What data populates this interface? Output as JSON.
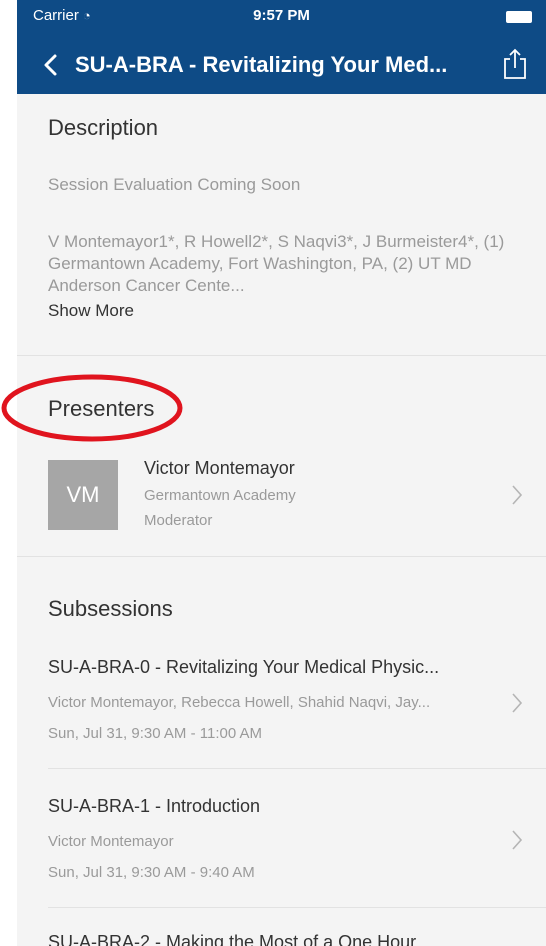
{
  "status": {
    "carrier": "Carrier",
    "time": "9:57 PM"
  },
  "nav": {
    "title": "SU-A-BRA - Revitalizing Your Med..."
  },
  "description": {
    "heading": "Description",
    "evaluation": "Session Evaluation Coming Soon",
    "text": "V Montemayor1*, R Howell2*, S Naqvi3*, J Burmeister4*, (1) Germantown Academy, Fort Washington, PA, (2) UT MD Anderson Cancer Cente...",
    "show_more": "Show More"
  },
  "presenters": {
    "heading": "Presenters",
    "items": [
      {
        "initials": "VM",
        "name": "Victor Montemayor",
        "affiliation": "Germantown Academy",
        "role": "Moderator"
      }
    ]
  },
  "subsessions": {
    "heading": "Subsessions",
    "items": [
      {
        "title": "SU-A-BRA-0 - Revitalizing Your Medical Physic...",
        "presenters": "Victor Montemayor, Rebecca Howell, Shahid Naqvi, Jay...",
        "time": "Sun, Jul 31, 9:30 AM - 11:00 AM"
      },
      {
        "title": "SU-A-BRA-1 - Introduction",
        "presenters": "Victor Montemayor",
        "time": "Sun, Jul 31, 9:30 AM - 9:40 AM"
      },
      {
        "title": "SU-A-BRA-2 - Making the Most of a One Hour",
        "presenters": "",
        "time": ""
      }
    ]
  },
  "colors": {
    "nav_bar": "#0e4b86",
    "background": "#f4f4f4",
    "annotation": "#e0141e",
    "avatar": "#a6a6a6"
  }
}
